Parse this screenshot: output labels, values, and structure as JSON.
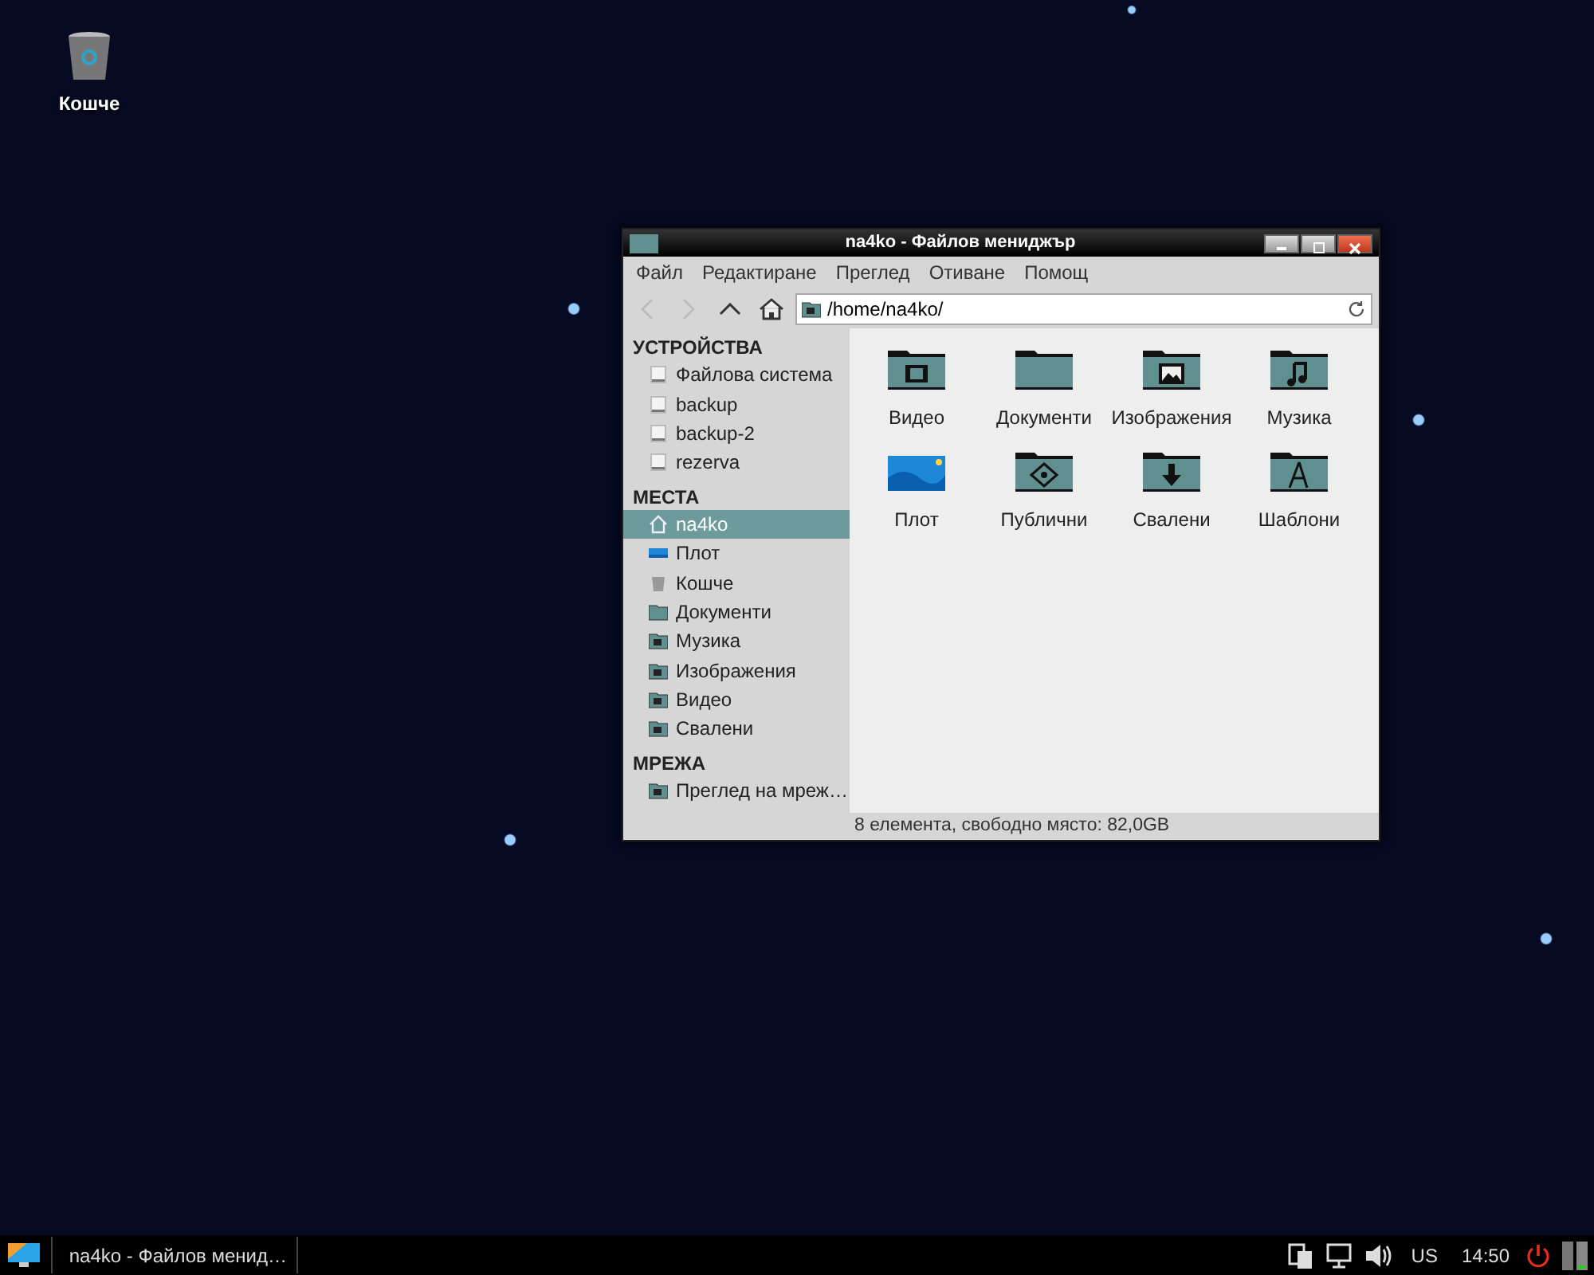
{
  "desktop_icons": [
    {
      "label": "Кошче",
      "kind": "trash"
    }
  ],
  "window": {
    "title": "na4ko - Файлов мениджър",
    "menu": [
      "Файл",
      "Редактиране",
      "Преглед",
      "Отиване",
      "Помощ"
    ],
    "toolbar": [
      {
        "kind": "back",
        "disabled": true
      },
      {
        "kind": "forward",
        "disabled": true
      },
      {
        "kind": "up",
        "disabled": false
      },
      {
        "kind": "home",
        "disabled": false
      }
    ],
    "location": {
      "value": "/home/na4ko/"
    },
    "sidebar": [
      {
        "title": "УСТРОЙСТВА",
        "items": [
          {
            "label": "Файлова система",
            "kind": "drive",
            "selected": false
          },
          {
            "label": "backup",
            "kind": "drive",
            "selected": false
          },
          {
            "label": "backup-2",
            "kind": "drive",
            "selected": false
          },
          {
            "label": "rezerva",
            "kind": "drive",
            "selected": false
          }
        ]
      },
      {
        "title": "МЕСТА",
        "items": [
          {
            "label": "na4ko",
            "kind": "home",
            "selected": true
          },
          {
            "label": "Плот",
            "kind": "desktop",
            "selected": false
          },
          {
            "label": "Кошче",
            "kind": "trash",
            "selected": false
          },
          {
            "label": "Документи",
            "kind": "folder",
            "selected": false
          },
          {
            "label": "Музика",
            "kind": "music",
            "selected": false
          },
          {
            "label": "Изображения",
            "kind": "pictures",
            "selected": false
          },
          {
            "label": "Видео",
            "kind": "video",
            "selected": false
          },
          {
            "label": "Свалени",
            "kind": "download",
            "selected": false
          }
        ]
      },
      {
        "title": "МРЕЖА",
        "items": [
          {
            "label": "Преглед на мреж…",
            "kind": "network",
            "selected": false
          }
        ]
      }
    ],
    "files": [
      {
        "label": "Видео",
        "kind": "video"
      },
      {
        "label": "Документи",
        "kind": "folder"
      },
      {
        "label": "Изображения",
        "kind": "pictures"
      },
      {
        "label": "Музика",
        "kind": "music"
      },
      {
        "label": "Плот",
        "kind": "desktop"
      },
      {
        "label": "Публични",
        "kind": "public"
      },
      {
        "label": "Свалени",
        "kind": "download"
      },
      {
        "label": "Шаблони",
        "kind": "templates"
      }
    ],
    "status_bar": "8 елемента, свободно място: 82,0GB"
  },
  "taskbar": {
    "tasks": [
      {
        "label": "na4ko - Файлов менид…",
        "selected": false
      }
    ],
    "keyboard": "US",
    "clock": "14:50"
  }
}
